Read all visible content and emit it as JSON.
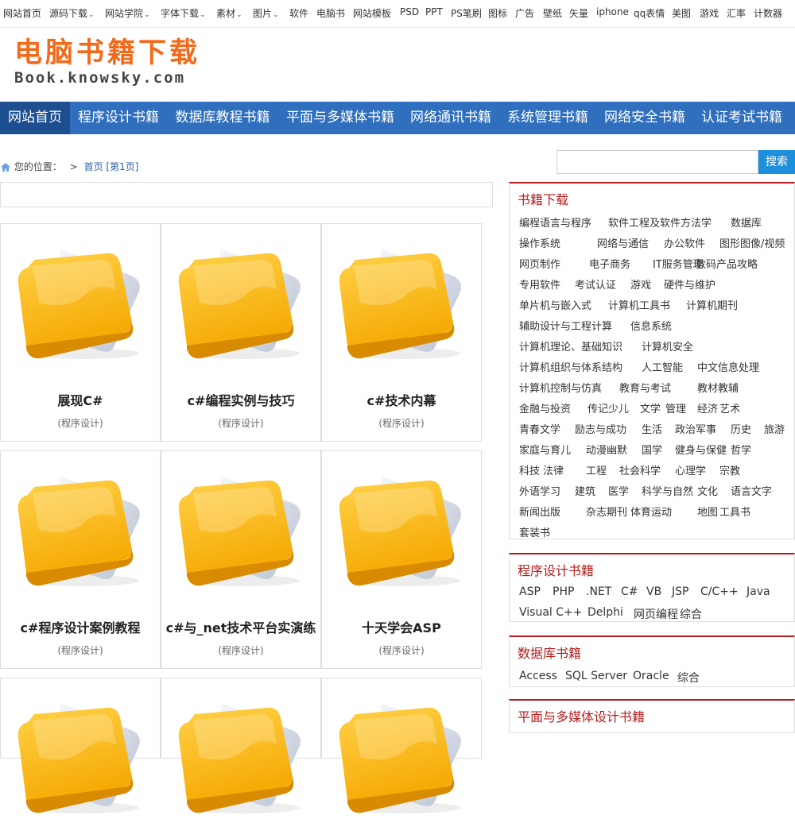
{
  "top_nav": [
    {
      "label": "网站首页",
      "dropdown": false
    },
    {
      "label": "源码下载",
      "dropdown": true
    },
    {
      "label": "网站学院",
      "dropdown": true
    },
    {
      "label": "字体下载",
      "dropdown": true
    },
    {
      "label": "素材",
      "dropdown": true
    },
    {
      "label": "图片",
      "dropdown": true
    },
    {
      "label": "软件",
      "dropdown": false
    },
    {
      "label": "电脑书",
      "dropdown": false
    },
    {
      "label": "网站模板",
      "dropdown": false
    },
    {
      "label": "PSD",
      "dropdown": false
    },
    {
      "label": "PPT",
      "dropdown": false
    },
    {
      "label": "PS笔刷",
      "dropdown": false
    },
    {
      "label": "图标",
      "dropdown": false
    },
    {
      "label": "广告",
      "dropdown": false
    },
    {
      "label": "壁纸",
      "dropdown": false
    },
    {
      "label": "矢量",
      "dropdown": false
    },
    {
      "label": "iphone",
      "dropdown": false
    },
    {
      "label": "qq表情",
      "dropdown": false
    },
    {
      "label": "美图",
      "dropdown": false
    },
    {
      "label": "游戏",
      "dropdown": false
    },
    {
      "label": "汇率",
      "dropdown": false
    },
    {
      "label": "计数器",
      "dropdown": false
    }
  ],
  "logo": {
    "cn": "电脑书籍下载",
    "en": "Book.knowsky.com"
  },
  "main_nav": [
    "网站首页",
    "程序设计书籍",
    "数据库教程书籍",
    "平面与多媒体书籍",
    "网络通讯书籍",
    "系统管理书籍",
    "网络安全书籍",
    "认证考试书籍"
  ],
  "breadcrumb": {
    "prefix": "您的位置：",
    "sep": ">",
    "home": "首页",
    "page": "[第1页]"
  },
  "books": [
    {
      "title": "展现C#",
      "category": "(程序设计)"
    },
    {
      "title": "c#编程实例与技巧",
      "category": "(程序设计)"
    },
    {
      "title": "c#技术内幕",
      "category": "(程序设计)"
    },
    {
      "title": "c#程序设计案例教程",
      "category": "(程序设计)"
    },
    {
      "title": "c#与_net技术平台实演练",
      "category": "(程序设计)"
    },
    {
      "title": "十天学会ASP",
      "category": "(程序设计)"
    },
    {
      "title": "",
      "category": ""
    },
    {
      "title": "",
      "category": ""
    },
    {
      "title": "",
      "category": ""
    }
  ],
  "search": {
    "placeholder": "",
    "button": "搜索"
  },
  "sidebar": {
    "book_download": {
      "title": "书籍下载",
      "rows": [
        [
          "编程语言与程序",
          "软件工程及软件方法学",
          "数据库"
        ],
        [
          "操作系统",
          "网络与通信",
          "办公软件",
          "图形图像/视频"
        ],
        [
          "网页制作",
          "电子商务",
          "IT服务管理",
          "数码产品攻略"
        ],
        [
          "专用软件",
          "考试认证",
          "游戏",
          "硬件与维护"
        ],
        [
          "单片机与嵌入式",
          "计算机工具书",
          "计算机期刊"
        ],
        [
          "辅助设计与工程计算",
          "信息系统"
        ],
        [
          "计算机理论、基础知识",
          "计算机安全"
        ],
        [
          "计算机组织与体系结构",
          "人工智能",
          "中文信息处理"
        ],
        [
          "计算机控制与仿真",
          "教育与考试",
          "教材教辅"
        ],
        [
          "金融与投资",
          "传记",
          "少儿",
          "文学",
          "管理",
          "经济",
          "艺术"
        ],
        [
          "青春文学",
          "励志与成功",
          "生活",
          "政治军事",
          "历史",
          "旅游"
        ],
        [
          "家庭与育儿",
          "动漫幽默",
          "国学",
          "健身与保健",
          "哲学"
        ],
        [
          "科技",
          "法律",
          "工程",
          "社会科学",
          "心理学",
          "宗教"
        ],
        [
          "外语学习",
          "建筑",
          "医学",
          "科学与自然",
          "文化",
          "语言文字"
        ],
        [
          "新闻出版",
          "杂志期刊",
          "体育运动",
          "地图",
          "工具书"
        ],
        [
          "套装书"
        ]
      ]
    },
    "programming": {
      "title": "程序设计书籍",
      "rows": [
        [
          "ASP",
          "PHP",
          ".NET",
          "C#",
          "VB",
          "JSP",
          "C/C++",
          "Java"
        ],
        [
          "Visual C++",
          "Delphi",
          "网页编程",
          "综合"
        ]
      ]
    },
    "database": {
      "title": "数据库书籍",
      "rows": [
        [
          "Access",
          "SQL Server",
          "Oracle",
          "综合"
        ]
      ]
    },
    "multimedia": {
      "title": "平面与多媒体设计书籍"
    }
  },
  "colors": {
    "nav_blue": "#2f6fbe",
    "nav_active": "#1d4e8f",
    "accent_red": "#b51d1d",
    "search_blue": "#1d8fdc",
    "logo_orange": "#f26a1b"
  }
}
